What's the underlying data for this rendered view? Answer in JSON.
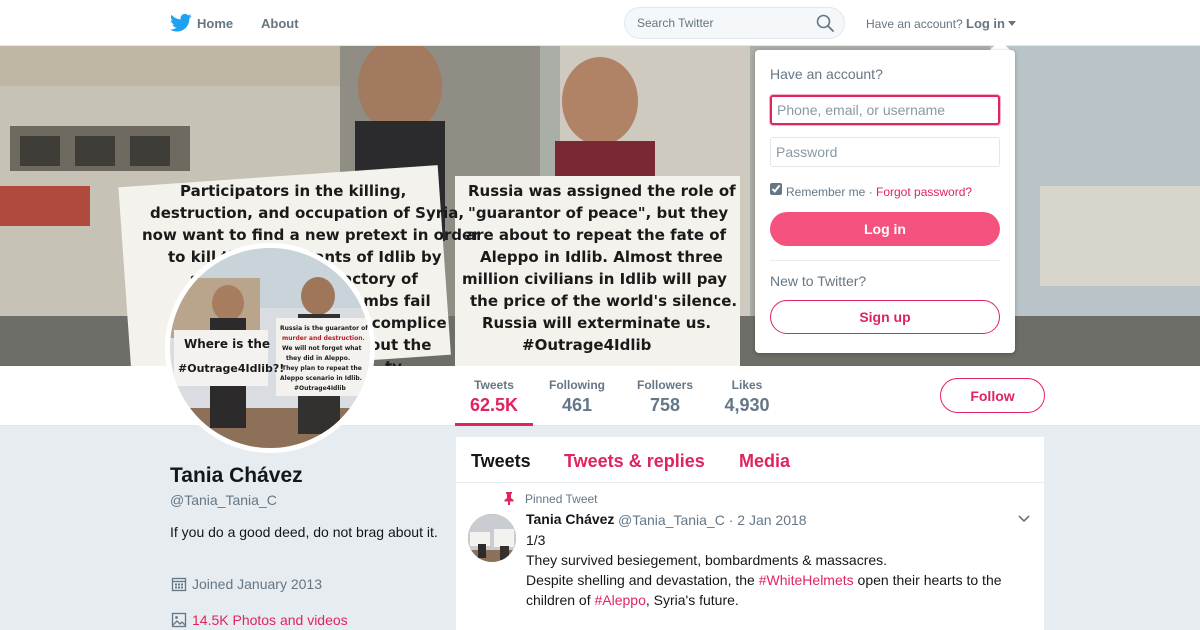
{
  "nav": {
    "home_label": "Home",
    "about_label": "About",
    "search_placeholder": "Search Twitter",
    "have_account": "Have an account?",
    "login_label": "Log in"
  },
  "banner": {
    "left_sign": [
      "Participators in the killing,",
      "destruction, and occupation of Syria,",
      "now want to find a new pretext in order",
      "to kill the inhabitants of Idlib by",
      "saying there is a factory of",
      "terrorists. Russian bombs fail",
      "to accomplice",
      "out the",
      "ty."
    ],
    "right_sign": [
      "Russia was assigned the role of",
      "\"guarantor of peace\", but they",
      "are about to repeat the fate of",
      "Aleppo in Idlib. Almost three",
      "million civilians in Idlib will pay",
      "the price of the world's silence.",
      "Russia will exterminate us.",
      "#Outrage4Idlib"
    ]
  },
  "avatar_signs": {
    "left": [
      "Where is the",
      "#Outrage4Idlib?!"
    ],
    "right": [
      "Russia is the guarantor of",
      "murder and destruction.",
      "We will not forget what",
      "they did in Aleppo.",
      "They plan to repeat the",
      "Aleppo scenario in Idlib.",
      "#Outrage4Idlib"
    ]
  },
  "stats": [
    {
      "label": "Tweets",
      "value": "62.5K"
    },
    {
      "label": "Following",
      "value": "461"
    },
    {
      "label": "Followers",
      "value": "758"
    },
    {
      "label": "Likes",
      "value": "4,930"
    }
  ],
  "follow_label": "Follow",
  "profile": {
    "name": "Tania Chávez",
    "handle": "@Tania_Tania_C",
    "bio": "If you do a good deed, do not brag about it.",
    "joined": "Joined January 2013",
    "photos": "14.5K Photos and videos"
  },
  "timeline": {
    "tabs": [
      "Tweets",
      "Tweets & replies",
      "Media"
    ],
    "pinned_label": "Pinned Tweet",
    "tweet": {
      "name": "Tania Chávez",
      "handle_date": "@Tania_Tania_C · 2 Jan 2018",
      "line1": "1/3",
      "line2": "They survived besiegement, bombardments & massacres.",
      "line3_pre": "Despite shelling and devastation, the ",
      "hashtag1": "#WhiteHelmets",
      "line3_post": " open their hearts to the",
      "line4_pre": "children of ",
      "hashtag2": "#Aleppo",
      "line4_post": ", Syria's future."
    }
  },
  "login_dropdown": {
    "title": "Have an account?",
    "user_placeholder": "Phone, email, or username",
    "pass_placeholder": "Password",
    "remember": "Remember me ·",
    "forgot": "Forgot password?",
    "login_button": "Log in",
    "new_prompt": "New to Twitter?",
    "signup_button": "Sign up"
  },
  "colors": {
    "accent": "#e0245e",
    "login_button": "#f4517f",
    "brand_bird": "#1da1f2",
    "muted": "#657786"
  }
}
